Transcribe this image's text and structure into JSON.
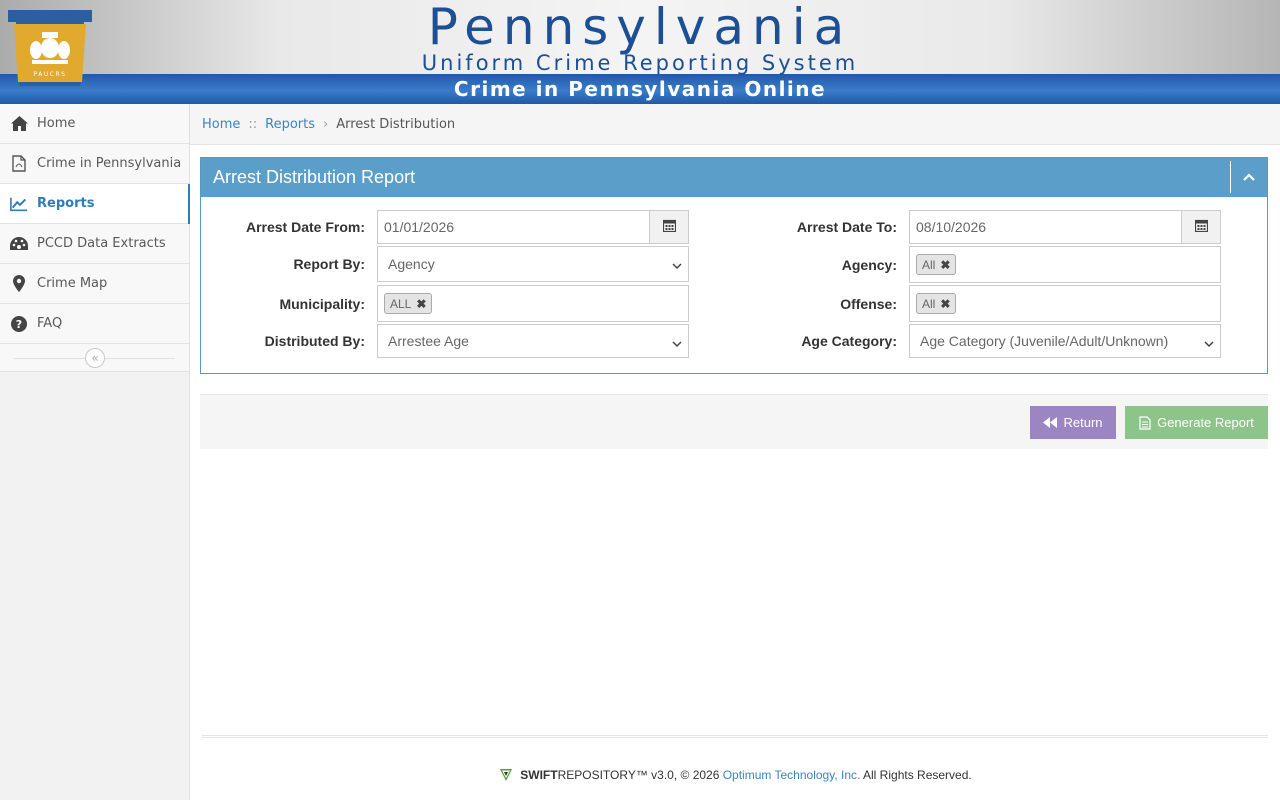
{
  "header": {
    "title": "Pennsylvania",
    "subtitle": "Uniform Crime Reporting System",
    "band": "Crime in Pennsylvania Online",
    "logo_text": "PAUCRS"
  },
  "sidebar": {
    "items": [
      {
        "label": "Home",
        "icon": "home-icon"
      },
      {
        "label": "Crime in Pennsylvania",
        "icon": "pdf-file-icon"
      },
      {
        "label": "Reports",
        "icon": "line-chart-icon",
        "active": true
      },
      {
        "label": "PCCD Data Extracts",
        "icon": "dashboard-icon"
      },
      {
        "label": "Crime Map",
        "icon": "map-marker-icon"
      },
      {
        "label": "FAQ",
        "icon": "question-circle-icon"
      }
    ],
    "collapse_glyph": "«"
  },
  "breadcrumb": {
    "home": "Home",
    "sep1": "::",
    "reports": "Reports",
    "sep2": "›",
    "current": "Arrest Distribution"
  },
  "panel": {
    "title": "Arrest Distribution Report",
    "fields": {
      "date_from": {
        "label": "Arrest Date From:",
        "value": "01/01/2026"
      },
      "date_to": {
        "label": "Arrest Date To:",
        "value": "08/10/2026"
      },
      "report_by": {
        "label": "Report By:",
        "value": "Agency"
      },
      "agency": {
        "label": "Agency:",
        "tag": "All"
      },
      "municipality": {
        "label": "Municipality:",
        "tag": "ALL"
      },
      "offense": {
        "label": "Offense:",
        "tag": "All"
      },
      "distributed_by": {
        "label": "Distributed By:",
        "value": "Arrestee Age"
      },
      "age_category": {
        "label": "Age Category:",
        "value": "Age Category (Juvenile/Adult/Unknown)"
      }
    },
    "tag_remove": "✖"
  },
  "actions": {
    "return_label": "Return",
    "generate_label": "Generate Report"
  },
  "footer": {
    "brand_bold": "SWIFT",
    "brand_rest": "REPOSITORY™",
    "version": " v3.0, © 2026 ",
    "company": "Optimum Technology, Inc.",
    "rights": " All Rights Reserved."
  },
  "colors": {
    "accent": "#2f7cb9",
    "panel_header": "#5a9ec9",
    "return_button": "#9b85c3",
    "generate_button": "#8dc48a",
    "header_band": "#1f5aa8"
  }
}
